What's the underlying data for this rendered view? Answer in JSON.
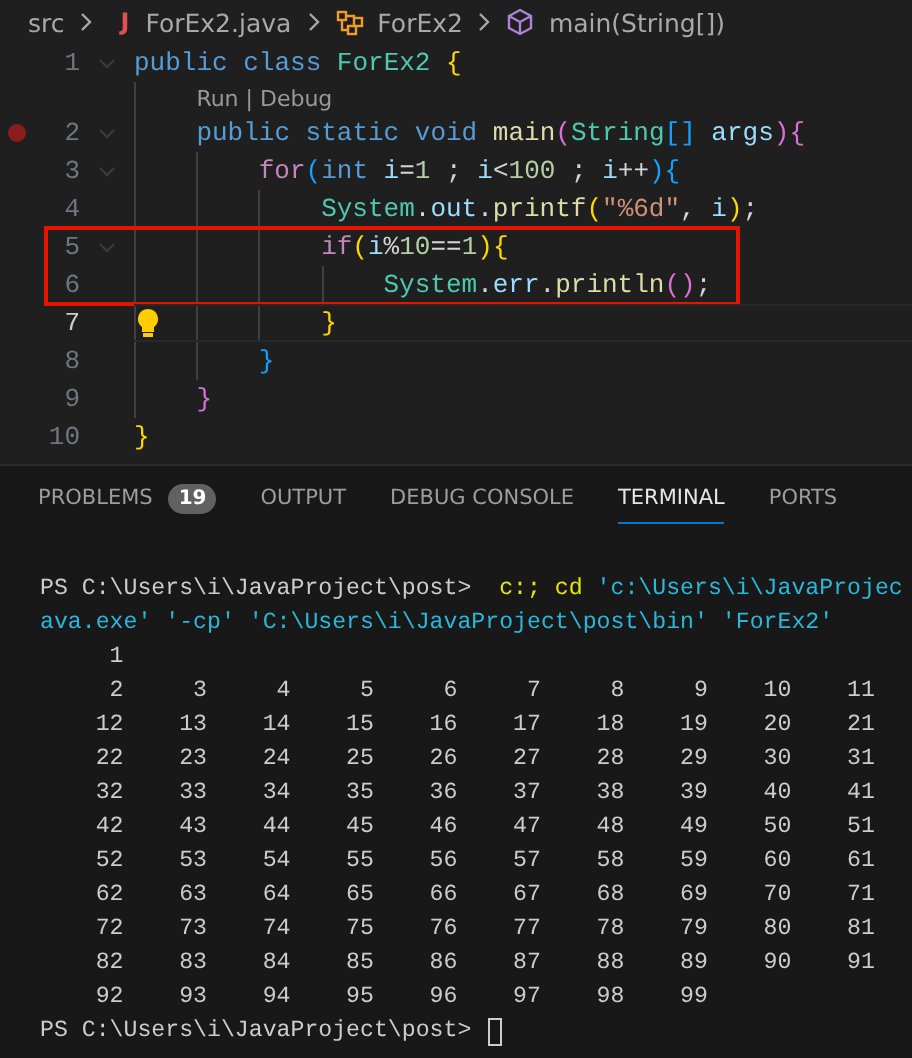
{
  "breadcrumb": [
    {
      "kind": "folder",
      "label": "src"
    },
    {
      "kind": "file",
      "icon_text": "J",
      "label": "ForEx2.java"
    },
    {
      "kind": "class",
      "label": "ForEx2"
    },
    {
      "kind": "method",
      "label": "main(String[])"
    }
  ],
  "editor": {
    "lines": [
      {
        "kind": "code",
        "number": "1",
        "foldable": true,
        "tokens": [
          {
            "kind": "kw",
            "text": "public class "
          },
          {
            "kind": "cls",
            "text": "ForEx2"
          },
          {
            "kind": "b1",
            "text": " {"
          }
        ],
        "children": [
          {
            "kind": "codelens",
            "links": [
              "Run",
              "Debug"
            ],
            "separator": "|"
          },
          {
            "kind": "code",
            "number": "2",
            "foldable": true,
            "breakpoint": true,
            "tokens": [
              {
                "kind": "kw",
                "text": "public static void "
              },
              {
                "kind": "fn",
                "text": "main"
              },
              {
                "kind": "b2",
                "text": "("
              },
              {
                "kind": "cls",
                "text": "String"
              },
              {
                "kind": "b3",
                "text": "[]"
              },
              {
                "kind": "var",
                "text": " args"
              },
              {
                "kind": "b2",
                "text": "){"
              }
            ],
            "children": [
              {
                "kind": "code",
                "number": "3",
                "foldable": true,
                "tokens": [
                  {
                    "kind": "ctrl",
                    "text": "for"
                  },
                  {
                    "kind": "b3",
                    "text": "("
                  },
                  {
                    "kind": "kw",
                    "text": "int"
                  },
                  {
                    "kind": "var",
                    "text": " i"
                  },
                  {
                    "kind": "p",
                    "text": "="
                  },
                  {
                    "kind": "num",
                    "text": "1"
                  },
                  {
                    "kind": "p",
                    "text": " ; "
                  },
                  {
                    "kind": "var",
                    "text": "i"
                  },
                  {
                    "kind": "p",
                    "text": "<"
                  },
                  {
                    "kind": "num",
                    "text": "100"
                  },
                  {
                    "kind": "p",
                    "text": " ; "
                  },
                  {
                    "kind": "var",
                    "text": "i"
                  },
                  {
                    "kind": "p",
                    "text": "++"
                  },
                  {
                    "kind": "b3",
                    "text": "){"
                  }
                ],
                "children": [
                  {
                    "kind": "code",
                    "number": "4",
                    "tokens": [
                      {
                        "kind": "cls",
                        "text": "System"
                      },
                      {
                        "kind": "p",
                        "text": "."
                      },
                      {
                        "kind": "var",
                        "text": "out"
                      },
                      {
                        "kind": "p",
                        "text": "."
                      },
                      {
                        "kind": "fn",
                        "text": "printf"
                      },
                      {
                        "kind": "b1",
                        "text": "("
                      },
                      {
                        "kind": "str",
                        "text": "\"%6d\""
                      },
                      {
                        "kind": "p",
                        "text": ", "
                      },
                      {
                        "kind": "var",
                        "text": "i"
                      },
                      {
                        "kind": "b1",
                        "text": ")"
                      },
                      {
                        "kind": "p",
                        "text": ";"
                      }
                    ]
                  },
                  {
                    "kind": "code",
                    "number": "5",
                    "foldable": true,
                    "boxed": true,
                    "tokens": [
                      {
                        "kind": "ctrl",
                        "text": "if"
                      },
                      {
                        "kind": "b1",
                        "text": "("
                      },
                      {
                        "kind": "var",
                        "text": "i"
                      },
                      {
                        "kind": "p",
                        "text": "%"
                      },
                      {
                        "kind": "num",
                        "text": "10"
                      },
                      {
                        "kind": "p",
                        "text": "=="
                      },
                      {
                        "kind": "num",
                        "text": "1"
                      },
                      {
                        "kind": "b1",
                        "text": "){"
                      }
                    ],
                    "children": [
                      {
                        "kind": "code",
                        "number": "6",
                        "boxed": true,
                        "tokens": [
                          {
                            "kind": "cls",
                            "text": "System"
                          },
                          {
                            "kind": "p",
                            "text": "."
                          },
                          {
                            "kind": "var",
                            "text": "err"
                          },
                          {
                            "kind": "p",
                            "text": "."
                          },
                          {
                            "kind": "fn",
                            "text": "println"
                          },
                          {
                            "kind": "b2",
                            "text": "()"
                          },
                          {
                            "kind": "p",
                            "text": ";"
                          }
                        ]
                      }
                    ]
                  },
                  {
                    "kind": "code",
                    "number": "7",
                    "current": true,
                    "lightbulb": true,
                    "tokens": [
                      {
                        "kind": "b1",
                        "text": "}"
                      }
                    ]
                  }
                ]
              },
              {
                "kind": "code",
                "number": "8",
                "tokens": [
                  {
                    "kind": "b3",
                    "text": "}"
                  }
                ]
              }
            ]
          },
          {
            "kind": "code",
            "number": "9",
            "tokens": [
              {
                "kind": "b2",
                "text": "}"
              }
            ]
          }
        ]
      },
      {
        "kind": "code",
        "number": "10",
        "tokens": [
          {
            "kind": "b1",
            "text": "}"
          }
        ]
      }
    ]
  },
  "panel_tabs": [
    {
      "label": "PROBLEMS",
      "badge": "19",
      "selected": false
    },
    {
      "label": "OUTPUT",
      "selected": false
    },
    {
      "label": "DEBUG CONSOLE",
      "selected": false
    },
    {
      "label": "TERMINAL",
      "selected": true
    },
    {
      "label": "PORTS",
      "selected": false
    }
  ],
  "terminal": {
    "lines": [
      {
        "segments": [
          {
            "kind": "plain",
            "text": "PS C:\\Users\\i\\JavaProject\\post>  "
          },
          {
            "kind": "cmd",
            "text": "c:; cd"
          },
          {
            "kind": "arg",
            "text": " 'c:\\Users\\i\\JavaProjec"
          }
        ]
      },
      {
        "segments": [
          {
            "kind": "arg",
            "text": "ava.exe' '-cp' 'C:\\Users\\i\\JavaProject\\post\\bin' 'ForEx2'"
          }
        ]
      },
      {
        "segments": [
          {
            "kind": "plain",
            "text": "     1"
          }
        ]
      },
      {
        "segments": [
          {
            "kind": "plain",
            "text": "     2     3     4     5     6     7     8     9    10    11"
          }
        ]
      },
      {
        "segments": [
          {
            "kind": "plain",
            "text": "    12    13    14    15    16    17    18    19    20    21"
          }
        ]
      },
      {
        "segments": [
          {
            "kind": "plain",
            "text": "    22    23    24    25    26    27    28    29    30    31"
          }
        ]
      },
      {
        "segments": [
          {
            "kind": "plain",
            "text": "    32    33    34    35    36    37    38    39    40    41"
          }
        ]
      },
      {
        "segments": [
          {
            "kind": "plain",
            "text": "    42    43    44    45    46    47    48    49    50    51"
          }
        ]
      },
      {
        "segments": [
          {
            "kind": "plain",
            "text": "    52    53    54    55    56    57    58    59    60    61"
          }
        ]
      },
      {
        "segments": [
          {
            "kind": "plain",
            "text": "    62    63    64    65    66    67    68    69    70    71"
          }
        ]
      },
      {
        "segments": [
          {
            "kind": "plain",
            "text": "    72    73    74    75    76    77    78    79    80    81"
          }
        ]
      },
      {
        "segments": [
          {
            "kind": "plain",
            "text": "    82    83    84    85    86    87    88    89    90    91"
          }
        ]
      },
      {
        "segments": [
          {
            "kind": "plain",
            "text": "    92    93    94    95    96    97    98    99"
          }
        ]
      },
      {
        "segments": [
          {
            "kind": "plain",
            "text": "PS C:\\Users\\i\\JavaProject\\post> "
          }
        ],
        "cursor": true
      }
    ]
  }
}
